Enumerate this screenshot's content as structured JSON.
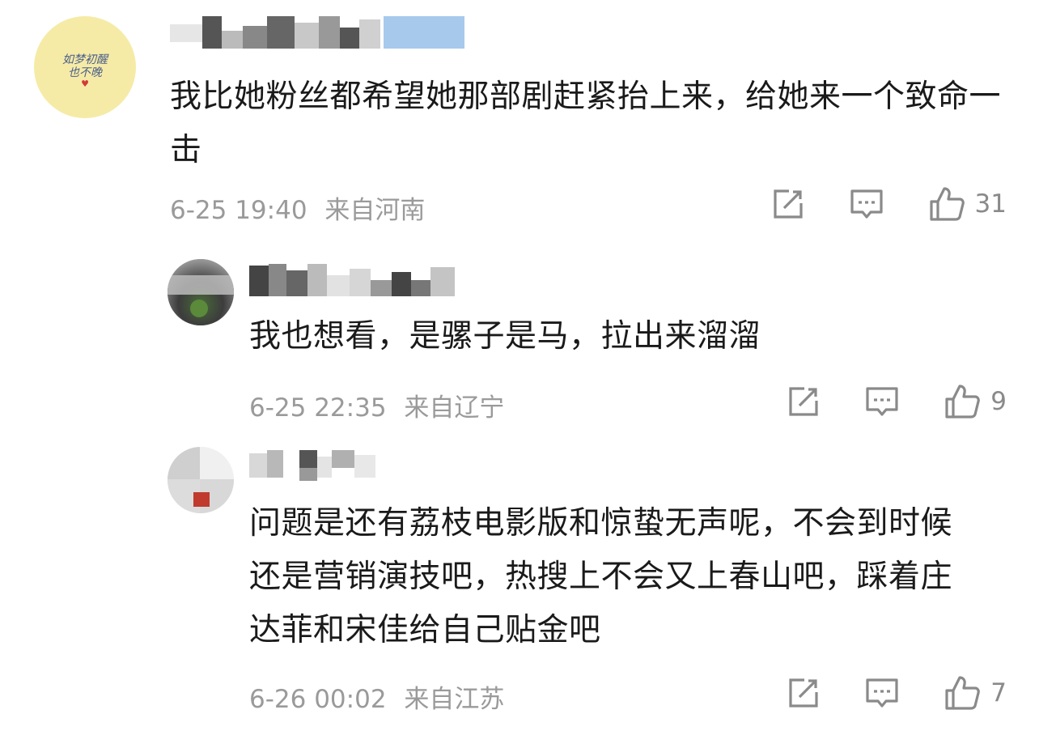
{
  "comments": [
    {
      "text": "我比她粉丝都希望她那部剧赶紧抬上来，给她来一个致命一击",
      "time": "6-25 19:40",
      "location": "来自河南",
      "likes": "31",
      "avatar_text_line1": "如梦初醒",
      "avatar_text_line2": "也不晚"
    },
    {
      "text": "我也想看，是骡子是马，拉出来溜溜",
      "time": "6-25 22:35",
      "location": "来自辽宁",
      "likes": "9"
    },
    {
      "text": "问题是还有荔枝电影版和惊蛰无声呢，不会到时候还是营销演技吧，热搜上不会又上春山吧，踩着庄达菲和宋佳给自己贴金吧",
      "time": "6-26 00:02",
      "location": "来自江苏",
      "likes": "7"
    }
  ],
  "icons": {
    "share": "share-icon",
    "reply": "comment-icon",
    "like": "thumbs-up-icon"
  },
  "colors": {
    "text": "#1a1a1a",
    "meta": "#9a9a9a",
    "icon": "#8a8a8a",
    "avatar1_bg": "#f5eba6"
  }
}
